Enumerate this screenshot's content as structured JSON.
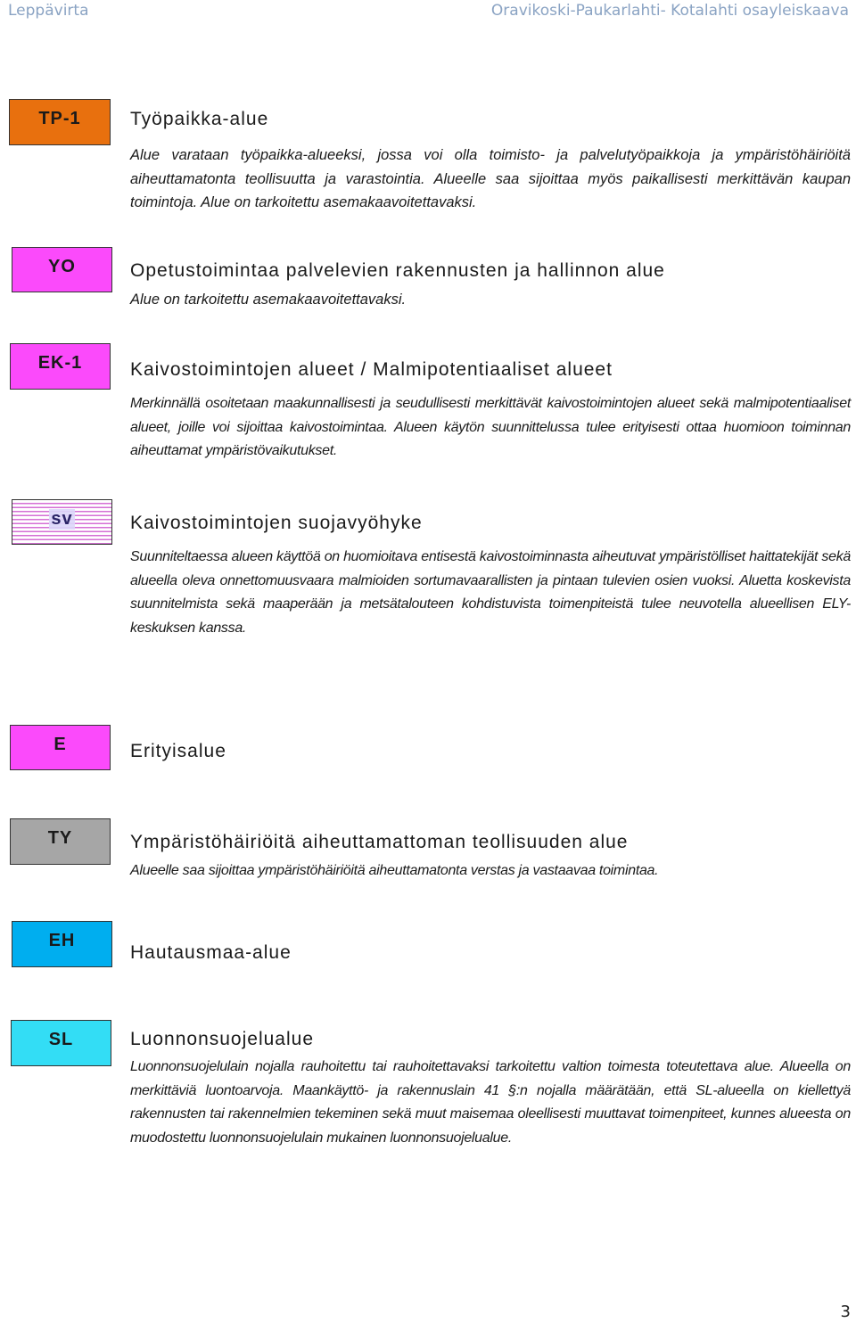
{
  "header": {
    "left": "Leppävirta",
    "right": "Oravikoski-Paukarlahti- Kotalahti osayleiskaava"
  },
  "entries": [
    {
      "code": "TP-1",
      "color": "#e8700e",
      "title": "Työpaikka-alue",
      "description": "Alue varataan työpaikka-alueeksi, jossa voi olla toimisto- ja palvelutyöpaikkoja ja ympäristöhäiriöitä aiheuttamatonta teollisuutta ja varastointia. Alueelle saa sijoittaa myös paikallisesti merkittävän kaupan toimintoja. Alue on tarkoitettu asemakaavoitettavaksi."
    },
    {
      "code": "YO",
      "color": "#fb4afb",
      "title": "Opetustoimintaa palvelevien rakennusten ja hallinnon alue",
      "description": "Alue on tarkoitettu asemakaavoitettavaksi."
    },
    {
      "code": "EK-1",
      "color": "#fb4afb",
      "title": "Kaivostoimintojen alueet / Malmipotentiaaliset alueet",
      "description": "Merkinnällä osoitetaan maakunnallisesti ja seudullisesti merkittävät kaivostoimintojen alueet sekä malmipotentiaaliset alueet, joille voi sijoittaa kaivostoimintaa. Alueen käytön suunnittelussa tulee erityisesti ottaa huomioon toiminnan aiheuttamat ympäristövaikutukset."
    },
    {
      "code": "sv",
      "color": "#d56fd5",
      "title": "Kaivostoimintojen suojavyöhyke",
      "description": "Suunniteltaessa alueen käyttöä on huomioitava entisestä kaivostoiminnasta aiheutuvat ympäristölliset haittatekijät sekä alueella oleva onnettomuusvaara malmioiden sortumavaarallisten ja pintaan tulevien osien vuoksi. Aluetta koskevista suunnitelmista sekä maaperään ja metsätalouteen kohdistuvista toimenpiteistä tulee neuvotella alueellisen ELY-keskuksen kanssa."
    },
    {
      "code": "E",
      "color": "#fb4afb",
      "title": "Erityisalue",
      "description": ""
    },
    {
      "code": "TY",
      "color": "#a6a6a6",
      "title": "Ympäristöhäiriöitä aiheuttamattoman teollisuuden alue",
      "description": "Alueelle saa sijoittaa ympäristöhäiriöitä aiheuttamatonta verstas ja vastaavaa toimintaa."
    },
    {
      "code": "EH",
      "color": "#00aeef",
      "title": "Hautausmaa-alue",
      "description": ""
    },
    {
      "code": "SL",
      "color": "#33ddf5",
      "title": "Luonnonsuojelualue",
      "description": "Luonnonsuojelulain nojalla rauhoitettu tai rauhoitettavaksi tarkoitettu valtion toimesta toteutettava alue. Alueella on merkittäviä luontoarvoja. Maankäyttö- ja rakennuslain 41 §:n nojalla määrätään, että SL-alueella on kiellettyä rakennusten tai rakennelmien tekeminen sekä muut maisemaa oleellisesti muuttavat toimenpiteet, kunnes alueesta on muodostettu luonnonsuojelulain mukainen luonnonsuojelualue."
    }
  ],
  "page_number": "3"
}
